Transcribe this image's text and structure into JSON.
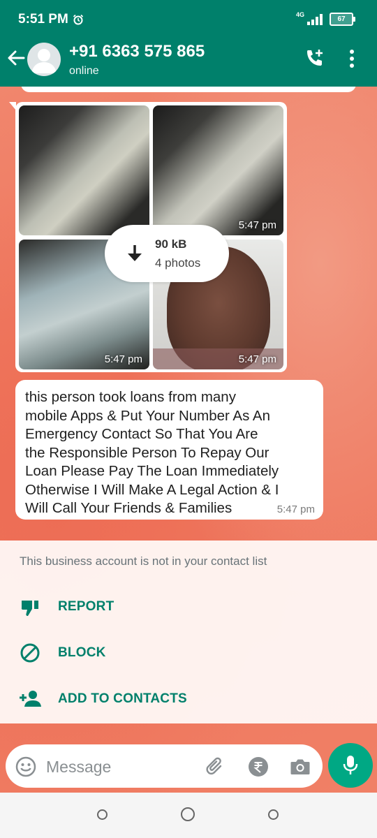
{
  "status_bar": {
    "time": "5:51 PM",
    "network": "4G",
    "battery": "67"
  },
  "header": {
    "contact_name": "+91 6363 575 865",
    "status": "online"
  },
  "media_message": {
    "size": "90 kB",
    "count": "4 photos",
    "photo_times": [
      "5:47 pm",
      "5:47 pm",
      "5:47 pm"
    ]
  },
  "text_message": {
    "text": "this person took loans from many\nmobile Apps & Put Your Number As An\nEmergency Contact  So That You Are\nthe Responsible Person To Repay Our\nLoan Please Pay The Loan Immediately\nOtherwise I Will Make A Legal Action & I\nWill Call Your Friends & Families",
    "time": "5:47 pm"
  },
  "business_notice": {
    "note": "This business account is not in your contact list",
    "actions": [
      {
        "label": "REPORT",
        "icon": "thumbs-down-icon"
      },
      {
        "label": "BLOCK",
        "icon": "block-icon"
      },
      {
        "label": "ADD TO CONTACTS",
        "icon": "add-person-icon"
      }
    ]
  },
  "composer": {
    "placeholder": "Message"
  },
  "colors": {
    "header": "#00806b",
    "accent": "#00a884",
    "action_text": "#00806b"
  }
}
